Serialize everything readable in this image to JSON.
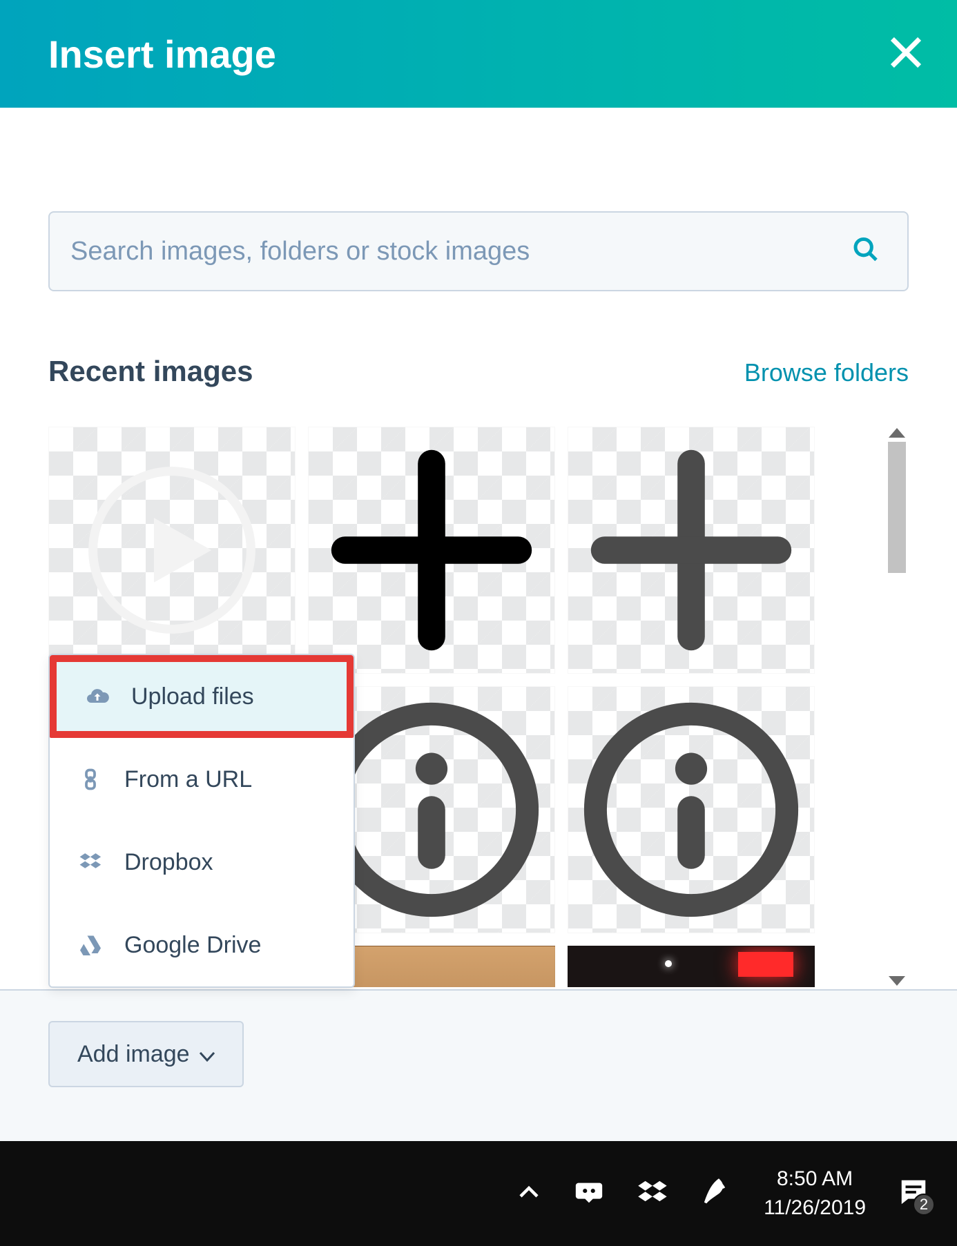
{
  "modal": {
    "title": "Insert image",
    "search": {
      "placeholder": "Search images, folders or stock images"
    },
    "section_title": "Recent images",
    "browse_label": "Browse folders",
    "add_button_label": "Add image"
  },
  "dropdown": {
    "items": [
      {
        "label": "Upload files",
        "icon": "cloud-upload-icon",
        "highlight": true
      },
      {
        "label": "From a URL",
        "icon": "link-icon",
        "highlight": false
      },
      {
        "label": "Dropbox",
        "icon": "dropbox-icon",
        "highlight": false
      },
      {
        "label": "Google Drive",
        "icon": "google-drive-icon",
        "highlight": false
      }
    ]
  },
  "gallery": {
    "items": [
      {
        "kind": "play",
        "color": "#f3f3f3"
      },
      {
        "kind": "plus",
        "color": "#000000"
      },
      {
        "kind": "plus",
        "color": "#4b4b4b"
      },
      {
        "kind": "info",
        "color": "#4b4b4b"
      },
      {
        "kind": "info",
        "color": "#4b4b4b"
      },
      {
        "kind": "photo1"
      },
      {
        "kind": "photo2"
      }
    ]
  },
  "taskbar": {
    "time": "8:50 AM",
    "date": "11/26/2019",
    "notifications": "2"
  }
}
